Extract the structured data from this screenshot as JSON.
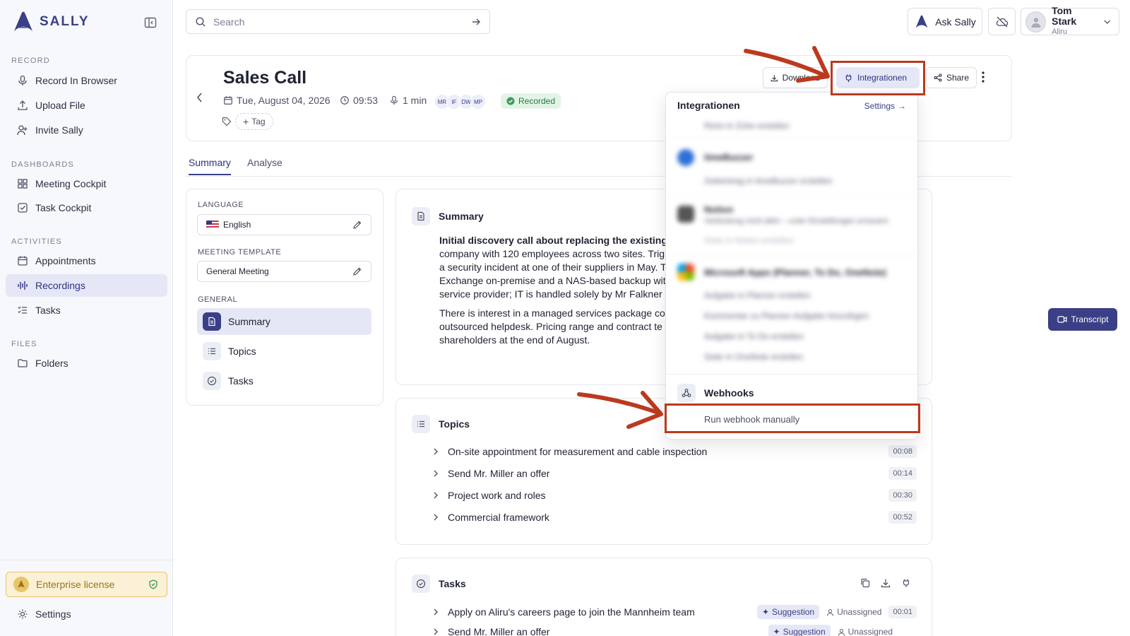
{
  "brand": {
    "name": "SALLY",
    "accent": "#3a3f86"
  },
  "sidebar": {
    "sections": [
      {
        "label": "RECORD",
        "items": [
          "Record In Browser",
          "Upload File",
          "Invite Sally"
        ]
      },
      {
        "label": "DASHBOARDS",
        "items": [
          "Meeting Cockpit",
          "Task Cockpit"
        ]
      },
      {
        "label": "ACTIVITIES",
        "items": [
          "Appointments",
          "Recordings",
          "Tasks"
        ]
      },
      {
        "label": "FILES",
        "items": [
          "Folders"
        ]
      }
    ],
    "active_item": "Recordings",
    "license": "Enterprise license",
    "settings": "Settings"
  },
  "topbar": {
    "search_placeholder": "Search",
    "ask_label": "Ask Sally",
    "user_name": "Tom Stark",
    "user_company": "Aliru"
  },
  "meeting": {
    "title": "Sales Call",
    "date": "Tue, August 04, 2026",
    "time": "09:53",
    "duration": "1 min",
    "participants": [
      "MR",
      "IF",
      "DW",
      "MP"
    ],
    "status": "Recorded",
    "tag_label": "Tag"
  },
  "header_buttons": {
    "download": "Download",
    "integrations": "Integrationen",
    "share": "Share"
  },
  "tabs": [
    "Summary",
    "Analyse"
  ],
  "left_panel": {
    "language_label": "LANGUAGE",
    "language_value": "English",
    "template_label": "MEETING TEMPLATE",
    "template_value": "General Meeting",
    "general_label": "GENERAL",
    "general_items": [
      "Summary",
      "Topics",
      "Tasks"
    ]
  },
  "summary_card": {
    "title": "Summary",
    "paragraph1_lines": [
      "Initial discovery call about replacing the existing o",
      "company with 120 employees across two sites. Trig",
      "a security incident at one of their suppliers in May. T",
      "Exchange on-premise and a NAS-based backup with",
      "service provider; IT is handled solely by Mr Falkner al"
    ],
    "paragraph2_lines": [
      "There is interest in a managed services package co",
      "outsourced helpdesk. Pricing range and contract te",
      "shareholders at the end of August."
    ]
  },
  "topics_card": {
    "title": "Topics",
    "items": [
      {
        "label": "On-site appointment for measurement and cable inspection",
        "time": "00:08"
      },
      {
        "label": "Send Mr. Miller an offer",
        "time": "00:14"
      },
      {
        "label": "Project work and roles",
        "time": "00:30"
      },
      {
        "label": "Commercial framework",
        "time": "00:52"
      }
    ]
  },
  "tasks_card": {
    "title": "Tasks",
    "items": [
      {
        "label": "Apply on Aliru's careers page to join the Mannheim team",
        "badge": "Suggestion",
        "assignee": "Unassigned",
        "time": "00:01"
      },
      {
        "label": "Send Mr. Miller an offer",
        "badge": "Suggestion",
        "assignee": "Unassigned",
        "time": ""
      }
    ]
  },
  "transcript_label": "Transcript",
  "integrations_dropdown": {
    "title": "Integrationen",
    "settings_link": "Settings",
    "blurred_groups": [
      {
        "name": "",
        "items": [
          "Rerio in Zohe erstellen"
        ]
      },
      {
        "name": "timeBuzzer",
        "items": [
          "Zeiteintrag in timeBuzzer erstellen"
        ]
      },
      {
        "name": "Notion",
        "items": [
          "Verbindung nicht aktiv – unter Einstellungen erneuern",
          "Seite in Notion erstellen"
        ]
      },
      {
        "name": "Microsoft Apps (Planner, To Do, OneNote)",
        "items": [
          "Aufgabe in Planner erstellen",
          "Kommentar zu Planner-Aufgabe hinzufügen",
          "Aufgabe in To Do erstellen",
          "Seite in OneNote erstellen"
        ]
      }
    ],
    "webhooks_title": "Webhooks",
    "webhook_action": "Run webhook manually"
  },
  "annotation_color": "#bb3a1f"
}
